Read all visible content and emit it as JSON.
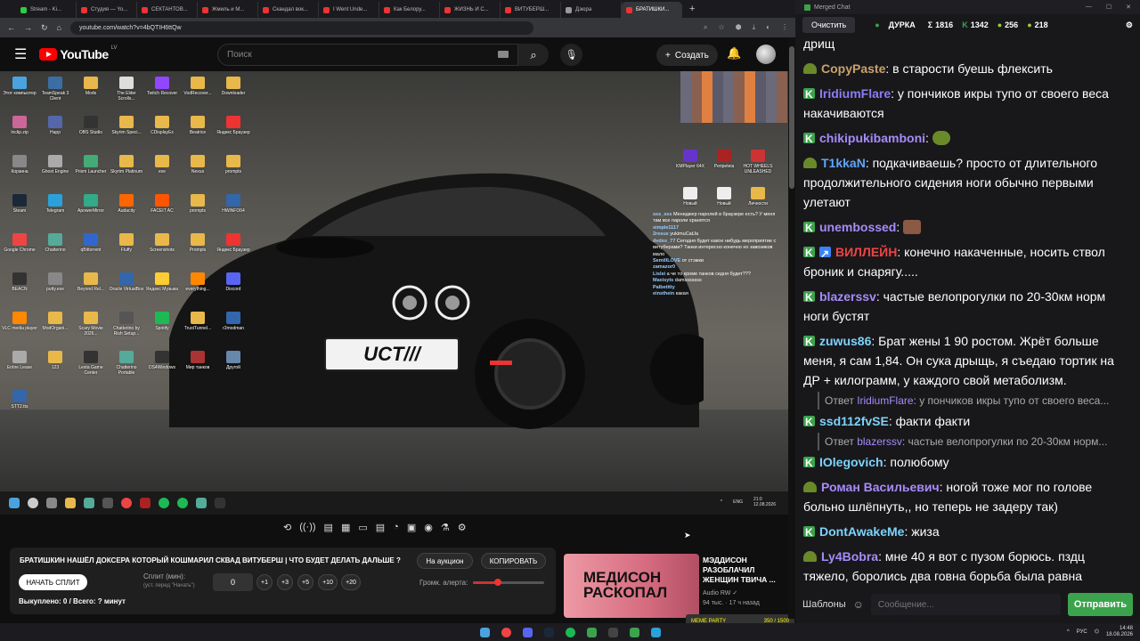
{
  "browser": {
    "tabs": [
      {
        "label": "Stream - Ki...",
        "color": "#2ecc40"
      },
      {
        "label": "Студия — Yo...",
        "color": "#e33"
      },
      {
        "label": "СЕКТАНТОВ...",
        "color": "#e33"
      },
      {
        "label": "Жмиль и М...",
        "color": "#e33"
      },
      {
        "label": "Скандал вок...",
        "color": "#e33"
      },
      {
        "label": "I Went Unde...",
        "color": "#e33"
      },
      {
        "label": "Как Белору...",
        "color": "#e33"
      },
      {
        "label": "ЖИЗНЬ И С...",
        "color": "#e33"
      },
      {
        "label": "ВИТУБЕРШ...",
        "color": "#e33"
      },
      {
        "label": "Дзюра",
        "color": "#999"
      },
      {
        "label": "БРАТИШКИ...",
        "color": "#e33"
      }
    ],
    "url": "youtube.com/watch?v=4bQTIH6ttQw",
    "new_tab": "+"
  },
  "youtube": {
    "logo": "YouTube",
    "region": "LV",
    "search_placeholder": "Поиск",
    "create_label": "Создать"
  },
  "video": {
    "desktop_icons": [
      {
        "label": "Этот компьютер",
        "color": "#4aa3df"
      },
      {
        "label": "TeamSpeak 3 Client",
        "color": "#3a6ea5"
      },
      {
        "label": "Mods",
        "color": "#e8b84a"
      },
      {
        "label": "The Elder Scrolls...",
        "color": "#ddd"
      },
      {
        "label": "Twitch Recover",
        "color": "#9146ff"
      },
      {
        "label": "VodRecover...",
        "color": "#e8b84a"
      },
      {
        "label": "Downloader",
        "color": "#e8b84a"
      },
      {
        "label": "Inclip.zip",
        "color": "#c69"
      },
      {
        "label": "Happ",
        "color": "#56a"
      },
      {
        "label": "OBS Studio",
        "color": "#333"
      },
      {
        "label": "Skyrim Speci...",
        "color": "#e8b84a"
      },
      {
        "label": "CDisplayEx",
        "color": "#e8b84a"
      },
      {
        "label": "Beatrice",
        "color": "#e8b84a"
      },
      {
        "label": "Яндекс Браузер",
        "color": "#e33"
      },
      {
        "label": "Корзина",
        "color": "#888"
      },
      {
        "label": "Ghost Engine",
        "color": "#aaa"
      },
      {
        "label": "Prism Launcher",
        "color": "#4a7"
      },
      {
        "label": "Skyrim Platinum",
        "color": "#e8b84a"
      },
      {
        "label": "exe",
        "color": "#e8b84a"
      },
      {
        "label": "Nexus",
        "color": "#e8b84a"
      },
      {
        "label": "prompts",
        "color": "#e8b84a"
      },
      {
        "label": "Steam",
        "color": "#1b2838"
      },
      {
        "label": "Telegram",
        "color": "#2aa1da"
      },
      {
        "label": "ApowerMirror",
        "color": "#3a8"
      },
      {
        "label": "Audacity",
        "color": "#f60"
      },
      {
        "label": "FACEIT AC",
        "color": "#f50"
      },
      {
        "label": "prompts",
        "color": "#e8b84a"
      },
      {
        "label": "HWiNFO64",
        "color": "#36a"
      },
      {
        "label": "Google Chrome",
        "color": "#e44"
      },
      {
        "label": "Chatterino",
        "color": "#5a9"
      },
      {
        "label": "qBittorrent",
        "color": "#36c"
      },
      {
        "label": "Fluffy",
        "color": "#e8b84a"
      },
      {
        "label": "Screenshots",
        "color": "#e8b84a"
      },
      {
        "label": "Prompts",
        "color": "#e8b84a"
      },
      {
        "label": "Яндекс Браузер",
        "color": "#e33"
      },
      {
        "label": "BEACN",
        "color": "#333"
      },
      {
        "label": "putty.exe",
        "color": "#888"
      },
      {
        "label": "Beyond Rel...",
        "color": "#e8b84a"
      },
      {
        "label": "Oracle VirtualBox",
        "color": "#36a"
      },
      {
        "label": "Яндекс Музыка",
        "color": "#fc3"
      },
      {
        "label": "everything...",
        "color": "#f80"
      },
      {
        "label": "Discord",
        "color": "#5865f2"
      },
      {
        "label": "VLC media player",
        "color": "#f80"
      },
      {
        "label": "ModOrgani...",
        "color": "#e8b84a"
      },
      {
        "label": "Scary Movie 2026...",
        "color": "#e8b84a"
      },
      {
        "label": "Chatterino by Rish Setup...",
        "color": "#555"
      },
      {
        "label": "Spotify",
        "color": "#1db954"
      },
      {
        "label": "TrustTunnel...",
        "color": "#e8b84a"
      },
      {
        "label": "r2modman",
        "color": "#36a"
      },
      {
        "label": "Entire Lease",
        "color": "#aaa"
      },
      {
        "label": "123",
        "color": "#e8b84a"
      },
      {
        "label": "Lesta Game Center",
        "color": "#333"
      },
      {
        "label": "Chatterino Portable",
        "color": "#5a9"
      },
      {
        "label": "DS4Windows",
        "color": "#333"
      },
      {
        "label": "Мир танков",
        "color": "#a33"
      },
      {
        "label": "Другой",
        "color": "#68a"
      },
      {
        "label": "STT2.tts",
        "color": "#36a"
      }
    ],
    "right_icons": [
      {
        "label": "KMPlayer 64X",
        "color": "#63c"
      },
      {
        "label": "Peripeteia",
        "color": "#a22"
      },
      {
        "label": "HOT WHEELS UNLEASHED",
        "color": "#c33"
      },
      {
        "label": "Новый",
        "color": "#eee"
      },
      {
        "label": "Новый",
        "color": "#eee"
      },
      {
        "label": "Личности",
        "color": "#e8b84a"
      }
    ],
    "plate": "UCT///",
    "overlay_chat": [
      {
        "user": "sss_sss",
        "text": "Менеджер паролей в браузере есть? У меня там все пароли хранятся"
      },
      {
        "user": "simple1117",
        "text": ""
      },
      {
        "user": "2resus",
        "text": "yukimuCatJa"
      },
      {
        "user": "dedox_77",
        "text": "Сегодня будет какое нибудь мероприятие с витуберами? Танки интересно конечно но завозиков мало"
      },
      {
        "user": "SemillLOVE",
        "text": "от стэжки"
      },
      {
        "user": "zamazor0",
        "text": ""
      },
      {
        "user": "Lislsi",
        "text": "а че то кроме танков седня будет???"
      },
      {
        "user": "Maxisyts",
        "text": "damsssssss"
      },
      {
        "user": "Palbetitty",
        "text": ""
      },
      {
        "user": "einsthein",
        "text": "какая"
      }
    ],
    "taskbar_time": "21:0",
    "taskbar_date": "12.08.2026",
    "taskbar_lang": "ENG"
  },
  "player_controls": [
    "⟲",
    "((·))",
    "▤",
    "▦",
    "▭",
    "▤",
    "◔",
    "▣",
    "◉",
    "⚗",
    "⚙"
  ],
  "panel": {
    "title": "БРАТИШКИН НАШЁЛ ДОКСЕРА КОТОРЫЙ КОШМАРИЛ СКВАД ВИТУБЕРШ | ЧТО БУДЕТ ДЕЛАТЬ ДАЛЬШЕ ?",
    "auction_label": "На аукцион",
    "copy_label": "КОПИРОВАТЬ",
    "start_split_label": "НАЧАТЬ СПЛИТ",
    "split_label": "Сплит (мин):",
    "split_hint": "(уст. перед \"Начать\")",
    "split_value": "0",
    "increments": [
      "+1",
      "+3",
      "+5",
      "+10",
      "+20"
    ],
    "volume_label": "Громк. алерта:",
    "volume_level": 0.35,
    "bought_text": "Выкуплено: 0 / Всего: ? минут"
  },
  "recommendation": {
    "thumb_text_1": "МЕДИСОН",
    "thumb_text_2": "РАСКОПАЛ",
    "title": "МЭДДИСОН РАЗОБЛАЧИЛ ЖЕНЩИН ТВИЧА ...",
    "channel": "Audio RW",
    "views": "94 тыс.",
    "age": "17 ч назад"
  },
  "hype": {
    "label": "MEME PARTY",
    "count": "350 / 1500"
  },
  "windows": {
    "lang": "РУС",
    "time": "14:48",
    "date": "18.08.2026"
  },
  "chat": {
    "window_title": "Merged Chat",
    "clear_label": "Очистить",
    "channel": "ДУРКА",
    "stats": [
      {
        "icon": "Σ",
        "value": "1816"
      },
      {
        "icon": "K",
        "value": "1342"
      },
      {
        "icon": "●",
        "value": "256"
      },
      {
        "icon": "●",
        "value": "218"
      }
    ],
    "messages": [
      {
        "badge": "none",
        "user": "",
        "color": "#fff",
        "text": "дрищ"
      },
      {
        "badge": "snake",
        "user": "CopyPaste",
        "color": "#c9a26b",
        "text": ": в старости буешь флексить"
      },
      {
        "badge": "k",
        "user": "IridiumFlare",
        "color": "#8b7cf6",
        "text": ": у пончиков икры тупо от своего веса накачиваются"
      },
      {
        "badge": "k",
        "user": "chikipukibamboni",
        "color": "#a78bfa",
        "text": ":"
      },
      {
        "badge": "snake",
        "user": "T1kkaN",
        "color": "#60a5fa",
        "text": ": подкачиваешь? просто от длительного продолжительного сидения ноги обычно первыми улетают"
      },
      {
        "badge": "k",
        "user": "unembossed",
        "color": "#a78bfa",
        "text": ":"
      },
      {
        "badge": "karrow",
        "user": "ВИЛЛЕЙН",
        "color": "#ef4444",
        "text": ": конечно накаченные, носить ствол броник и снарягу....."
      },
      {
        "badge": "k",
        "user": "blazerssv",
        "color": "#a78bfa",
        "text": ": частые велопрогулки по 20-30км норм ноги бустят"
      },
      {
        "badge": "k",
        "user": "zuwus86",
        "color": "#7dd3fc",
        "text": ": Брат жены 1 90 ростом. Жрёт больше меня, я сам 1,84. Он сука дрыщь, я съедаю тортик на ДР + килограмм, у каждого свой метаболизм."
      },
      {
        "badge": "reply",
        "user": "IridiumFlare",
        "color": "#a78bfa",
        "text": ": у пончиков икры тупо от своего веса...",
        "prefix": "Ответ"
      },
      {
        "badge": "k",
        "user": "ssd112fvSE",
        "color": "#7dd3fc",
        "text": ": факти факти"
      },
      {
        "badge": "reply",
        "user": "blazerssv",
        "color": "#a78bfa",
        "text": ": частые велопрогулки по 20-30км норм...",
        "prefix": "Ответ"
      },
      {
        "badge": "k",
        "user": "IOlegovich",
        "color": "#7dd3fc",
        "text": ": полюбому"
      },
      {
        "badge": "snake",
        "user": "Роман Васильевич",
        "color": "#a78bfa",
        "text": ": ногой тоже мог по голове больно шлёпнуть,, но теперь не задеру так)"
      },
      {
        "badge": "k",
        "user": "DontAwakeMe",
        "color": "#7dd3fc",
        "text": ": жиза"
      },
      {
        "badge": "snake",
        "user": "Ly4Bobra",
        "color": "#a78bfa",
        "text": ": мне 40 я вот с пузом борюсь. пздц тяжело, боролись два говна борьба была равна"
      }
    ],
    "templates_label": "Шаблоны",
    "input_placeholder": "Сообщение...",
    "send_label": "Отправить"
  }
}
